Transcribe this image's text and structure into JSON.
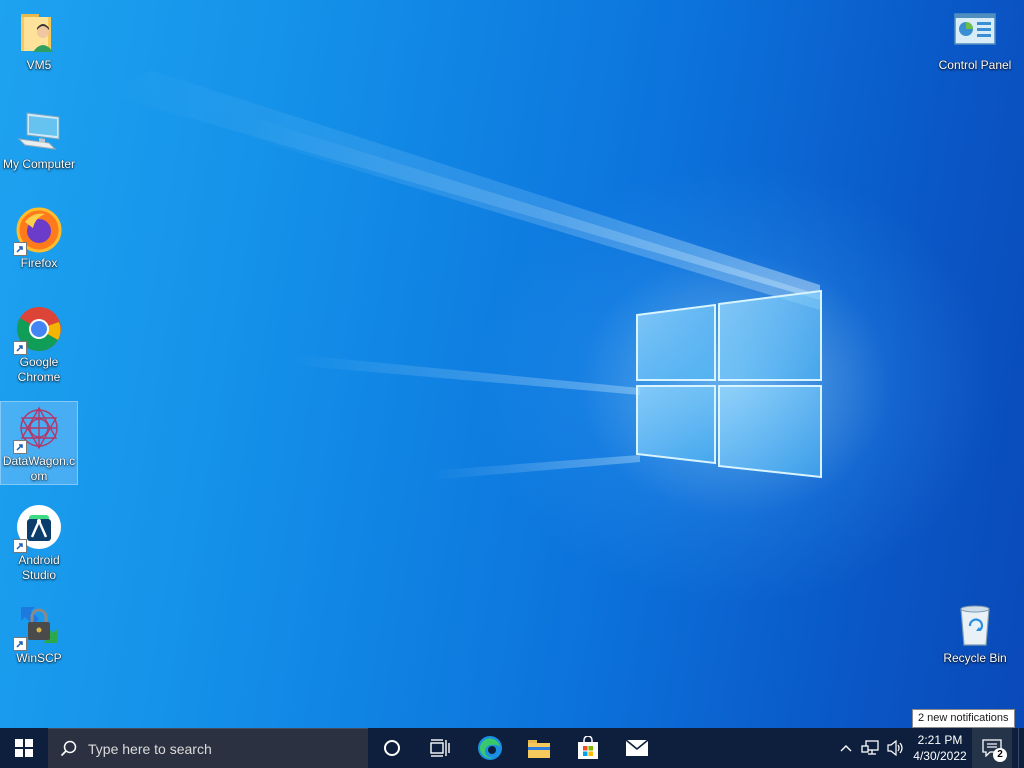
{
  "desktop": {
    "icons_left": [
      {
        "label": "VM5"
      },
      {
        "label": "My Computer"
      },
      {
        "label": "Firefox"
      },
      {
        "label": "Google Chrome"
      },
      {
        "label": "DataWagon.com",
        "selected": true
      },
      {
        "label": "Android Studio"
      },
      {
        "label": "WinSCP"
      }
    ],
    "icons_right": [
      {
        "label": "Control Panel"
      },
      {
        "label": "Recycle Bin"
      }
    ]
  },
  "taskbar": {
    "search_placeholder": "Type here to search",
    "pinned": [
      "start-icon",
      "cortana-icon",
      "task-view-icon",
      "edge-icon",
      "file-explorer-icon",
      "store-icon",
      "mail-icon"
    ],
    "clock_time": "2:21 PM",
    "clock_date": "4/30/2022",
    "notification_count": "2",
    "tooltip": "2 new notifications"
  },
  "colors": {
    "taskbar_bg": "#0d1f3c",
    "search_bg": "#2b3140",
    "desktop_accent": "#0a63d6"
  }
}
